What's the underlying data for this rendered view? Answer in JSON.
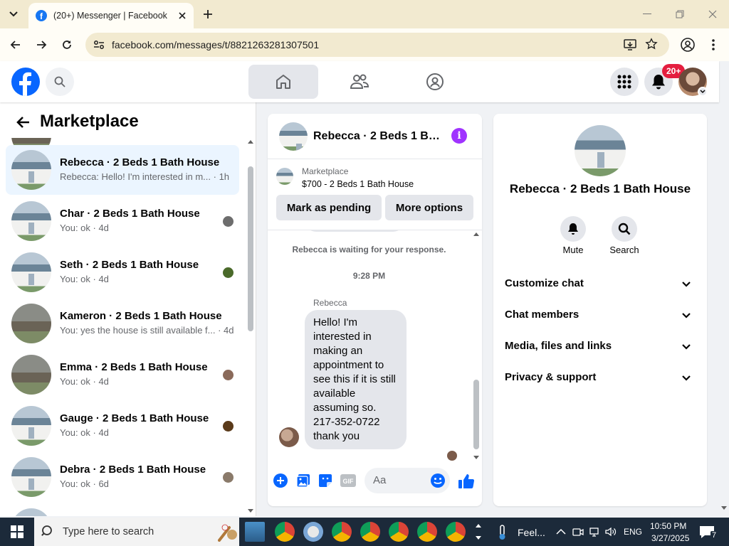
{
  "browser": {
    "tab_title": "(20+) Messenger | Facebook",
    "url": "facebook.com/messages/t/8821263281307501"
  },
  "fb_header": {
    "notification_badge": "20+"
  },
  "sidebar": {
    "title": "Marketplace",
    "chats": [
      {
        "name": "Rebecca · 2 Beds 1 Bath House",
        "snippet": "Rebecca: Hello! I'm interested in m...",
        "time": "· 1h",
        "thumb": "house",
        "active": true
      },
      {
        "name": "Char · 2 Beds 1 Bath House",
        "snippet": "You: ok · 4d",
        "thumb": "house"
      },
      {
        "name": "Seth · 2 Beds 1 Bath House",
        "snippet": "You: ok · 4d",
        "thumb": "house"
      },
      {
        "name": "Kameron · 2 Beds 1 Bath House",
        "snippet": "You: yes the house is still available f...",
        "time": "· 4d",
        "thumb": "tree"
      },
      {
        "name": "Emma · 2 Beds 1 Bath House",
        "snippet": "You: ok · 4d",
        "thumb": "tree"
      },
      {
        "name": "Gauge · 2 Beds 1 Bath House",
        "snippet": "You: ok · 4d",
        "thumb": "house"
      },
      {
        "name": "Debra · 2 Beds 1 Bath House",
        "snippet": "You: ok · 6d",
        "thumb": "house"
      }
    ]
  },
  "chat": {
    "title": "Rebecca · 2 Beds 1 Bath House",
    "marketplace_label": "Marketplace",
    "listing": "$700 - 2 Beds 1 Bath House",
    "mark_pending_label": "Mark as pending",
    "more_options_label": "More options",
    "status_text": "Rebecca is waiting for your response.",
    "timestamp": "9:28 PM",
    "sender": "Rebecca",
    "message": "Hello! I'm interested in making an appointment to see this if it is still available assuming so. 217-352-0722 thank you",
    "composer_placeholder": "Aa"
  },
  "info_panel": {
    "title": "Rebecca · 2 Beds 1 Bath House",
    "mute_label": "Mute",
    "search_label": "Search",
    "sections": [
      "Customize chat",
      "Chat members",
      "Media, files and links",
      "Privacy & support"
    ]
  },
  "taskbar": {
    "search_placeholder": "Type here to search",
    "weather": "Feel...",
    "language": "ENG",
    "time": "10:50 PM",
    "date": "3/27/2025",
    "notification_count": "7"
  },
  "colors": {
    "fb_blue": "#0866ff",
    "badge_red": "#e41e3f",
    "info_purple": "#a033ff",
    "active_chat_bg": "#ebf5ff"
  }
}
